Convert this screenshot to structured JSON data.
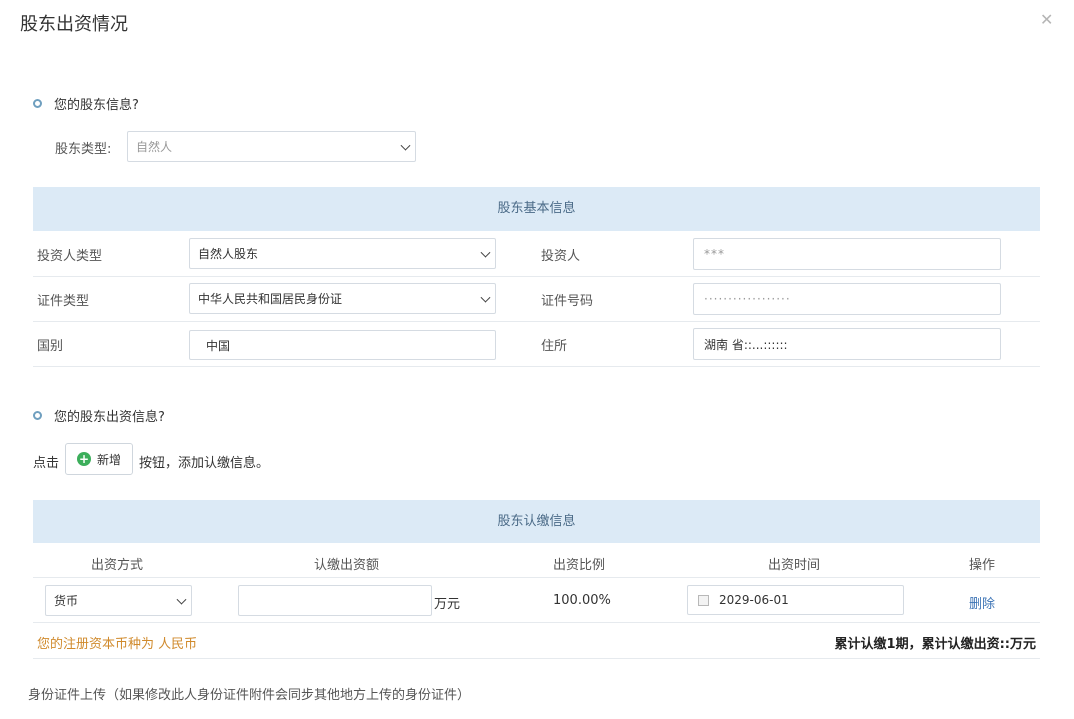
{
  "dialog": {
    "title": "股东出资情况",
    "close_icon": "close-icon"
  },
  "section1": {
    "heading": "您的股东信息?"
  },
  "shareholder_type": {
    "label": "股东类型:",
    "value": "自然人"
  },
  "basic_info": {
    "band_title": "股东基本信息",
    "investor_type_label": "投资人类型",
    "investor_type_value": "自然人股东",
    "investor_label": "投资人",
    "investor_value": "***",
    "id_type_label": "证件类型",
    "id_type_value": "中华人民共和国居民身份证",
    "id_number_label": "证件号码",
    "id_number_value": "··················",
    "nationality_label": "国别",
    "nationality_value": "中国",
    "address_label": "住所",
    "address_value": "湖南 省::...::::::"
  },
  "section2": {
    "heading": "您的股东出资信息?",
    "hint_prefix": "点击",
    "add_button": "新增",
    "hint_suffix": "按钮，添加认缴信息。"
  },
  "subscription": {
    "band_title": "股东认缴信息",
    "columns": [
      "出资方式",
      "认缴出资额",
      "出资比例",
      "出资时间",
      "操作"
    ],
    "row": {
      "method": "货币",
      "amount": "",
      "unit": "万元",
      "ratio": "100.00%",
      "date": "2029-06-01",
      "action": "删除"
    },
    "currency_note": "您的注册资本币种为 人民币",
    "summary": "累计认缴1期，累计认缴出资::万元"
  },
  "footer": {
    "upload_note": "身份证件上传（如果修改此人身份证件附件会同步其他地方上传的身份证件）"
  }
}
